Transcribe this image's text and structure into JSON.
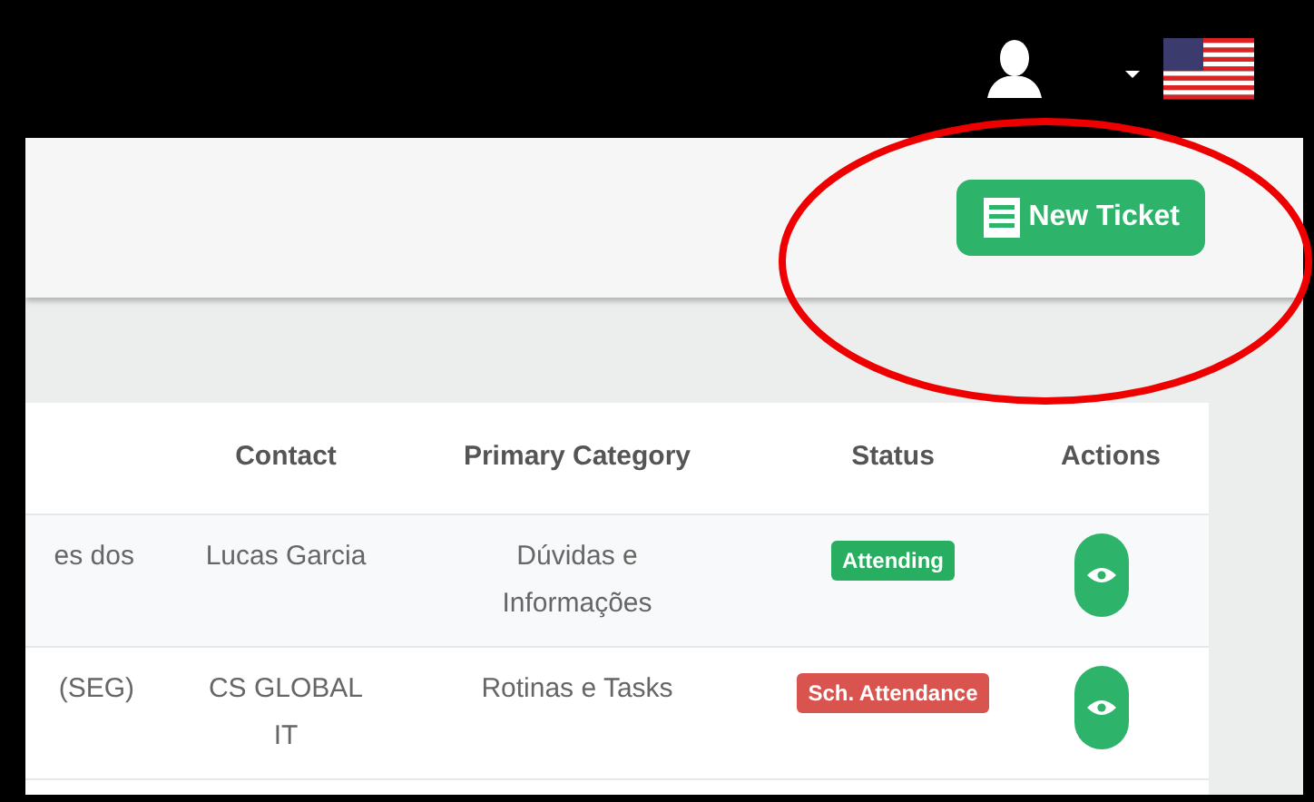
{
  "header": {
    "new_ticket_button": "New Ticket"
  },
  "table": {
    "columns": [
      "",
      "Contact",
      "Primary Category",
      "Status",
      "Actions"
    ],
    "rows": [
      {
        "column_1": "es dos",
        "contact": "Lucas Garcia",
        "category": "Dúvidas e Informações",
        "status": {
          "label": "Attending",
          "color": "#27ae60"
        }
      },
      {
        "column_1": "(SEG)",
        "contact": "CS GLOBAL IT",
        "category": "Rotinas e Tasks",
        "status": {
          "label": "Sch. Attendance",
          "color": "#d9534f"
        }
      }
    ]
  }
}
